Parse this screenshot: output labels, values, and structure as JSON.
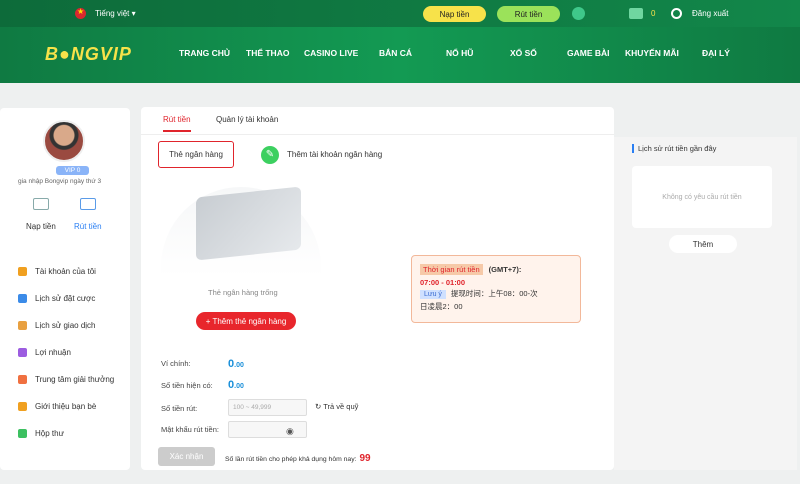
{
  "topbar": {
    "language": "Tiếng việt ▾",
    "deposit": "Nạp tiền",
    "withdraw": "Rút tiền",
    "balance": "0",
    "logout": "Đăng xuất"
  },
  "logo": {
    "part1": "B",
    "part2": "●",
    "part3": "NGVIP"
  },
  "menu": [
    "TRANG CHỦ",
    "THỂ THAO",
    "CASINO LIVE",
    "BẮN CÁ",
    "NỔ HŨ",
    "XỔ SỐ",
    "GAME BÀI",
    "KHUYẾN MÃI",
    "ĐẠI LÝ"
  ],
  "profile": {
    "vip": "VIP 0",
    "joined": "gia nhập Bongvip ngày thứ 3",
    "deposit": "Nạp tiền",
    "withdraw": "Rút tiền"
  },
  "sidebar": {
    "items": [
      "Tài khoản của tôi",
      "Lịch sử đặt cược",
      "Lịch sử giao dịch",
      "Lợi nhuận",
      "Trung tâm giải thưởng",
      "Giới thiệu bạn bè",
      "Hộp thư"
    ],
    "colors": [
      "#f0a020",
      "#3b8be8",
      "#e8a040",
      "#9c5ce0",
      "#f07040",
      "#f0a020",
      "#3cc060"
    ]
  },
  "tabs": {
    "withdraw": "Rút tiền",
    "account": "Quản lý tài khoản"
  },
  "bank": {
    "card": "Thẻ ngân hàng",
    "add_account": "Thêm tài khoản ngân hàng",
    "empty": "Thẻ ngân hàng trống",
    "add_card": "+ Thêm thẻ ngân hàng"
  },
  "info": {
    "time_label": "Thời gian rút tiền",
    "gmt": "(GMT+7):",
    "hours": "07:00 - 01:00",
    "note_label": "Lưu ý",
    "note": "提现时间：上午08：00-次",
    "note2": "日凌晨2：00"
  },
  "form": {
    "main_wallet": "Ví chính:",
    "main_value": "0",
    "main_dec": ".00",
    "available": "Số tiền hiện có:",
    "avail_value": "0",
    "avail_dec": ".00",
    "amount": "Số tiền rút:",
    "amount_placeholder": "100 ~ 49,999",
    "refund": "Trả về quỹ",
    "password": "Mật khẩu rút tiền:",
    "submit": "Xác nhận",
    "limit_text": "Số lần rút tiền cho phép khả dụng hôm nay:",
    "limit_value": "99"
  },
  "history": {
    "title": "Lịch sử rút tiền gần đây",
    "empty": "Không có yêu cầu rút tiền",
    "more": "Thêm"
  }
}
